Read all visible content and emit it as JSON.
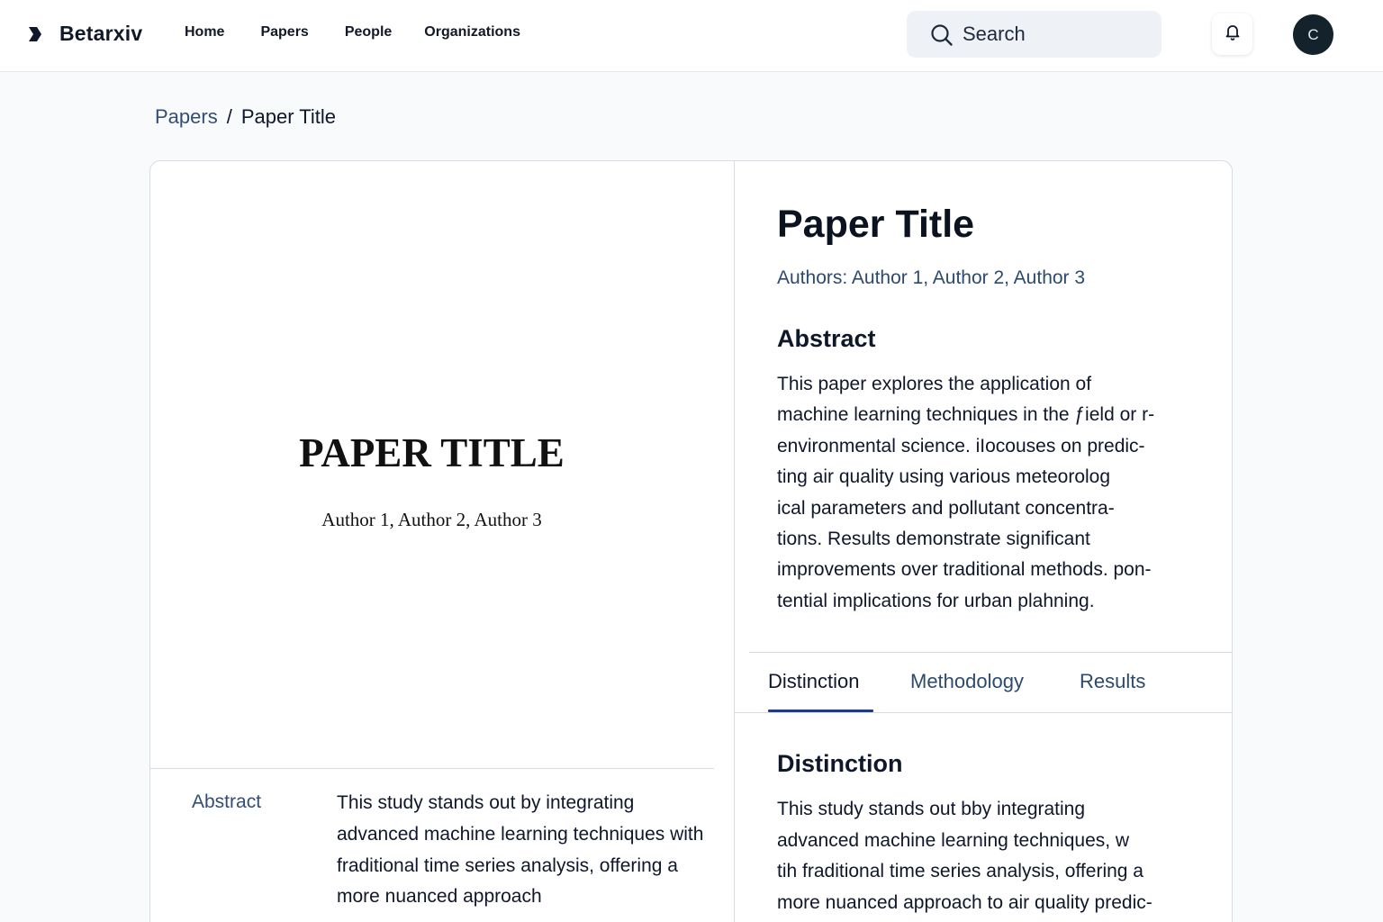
{
  "header": {
    "brand": "Betarxiv",
    "nav": [
      "Home",
      "Papers",
      "People",
      "Organizations"
    ],
    "search_placeholder": "Search",
    "avatar_initial": "C"
  },
  "breadcrumb": {
    "parent": "Papers",
    "separator": "/",
    "current": "Paper Title"
  },
  "preview": {
    "title": "PAPER TITLE",
    "authors": "Author 1, Author 2, Author 3",
    "abstract_label": "Abstract",
    "abstract_text": "This study stands out by integrating advanced machine learning techniques with fraditional time series analysis, offering a more nuanced approach"
  },
  "details": {
    "title": "Paper Title",
    "authors": "Authors: Author 1, Author 2, Author 3",
    "abstract_heading": "Abstract",
    "abstract_lines": [
      "This paper explores the application of",
      "machine learning techniques in the ƒield or r-",
      "environmental science. iIocouses on predic-",
      "ting air quality using various meteorolog",
      "ical parameters and pollutant concentra-",
      "tions. Results demonstrate significant",
      "improvements over traditional methods. pon-",
      "tential implications for urban plahning."
    ],
    "tabs": [
      "Distinction",
      "Methodology",
      "Results"
    ],
    "active_tab": "Distinction",
    "section_heading": "Distinction",
    "section_lines": [
      "This study stands out bby integrating",
      "advanced machine learning techniques, w",
      "tih fraditional time series analysis, offering a",
      "more nuanced approach to air quality predic-"
    ]
  }
}
